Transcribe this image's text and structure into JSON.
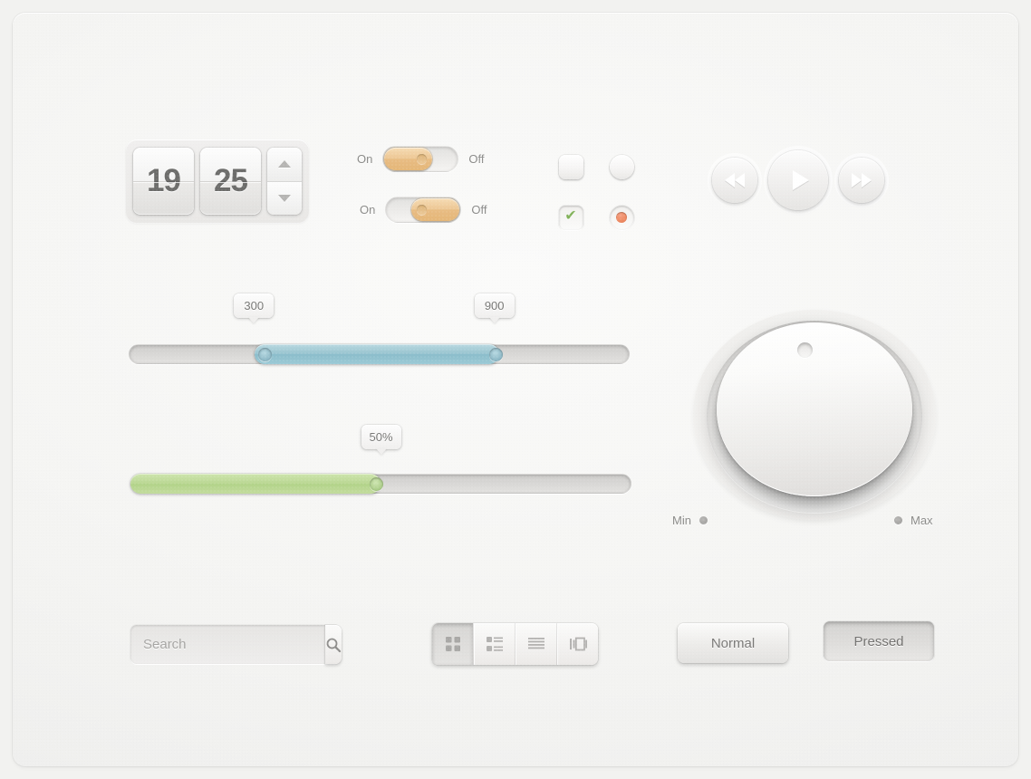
{
  "panel": {
    "background_color": "#f4f4f2",
    "accent_colors": {
      "switch_on": "#e8bc83",
      "range_fill": "#8bbdcb",
      "progress_fill": "#b2d389",
      "check_green": "#82b25a",
      "radio_orange": "#ee8b64",
      "text": "#7a7977"
    }
  },
  "clock": {
    "hours": "19",
    "minutes": "25",
    "stepper": {
      "up_icon": "triangle-up-icon",
      "down_icon": "triangle-down-icon"
    }
  },
  "switches": [
    {
      "on_label": "On",
      "off_label": "Off",
      "state": "on",
      "knob_position": "left"
    },
    {
      "on_label": "On",
      "off_label": "Off",
      "state": "off",
      "knob_position": "right"
    }
  ],
  "choices": {
    "checkbox_unchecked": {
      "checked": false,
      "icon": "checkbox-icon"
    },
    "radio_unselected": {
      "checked": false,
      "icon": "radio-icon"
    },
    "checkbox_checked": {
      "checked": true,
      "icon": "check-mark-icon",
      "glyph": "✔"
    },
    "radio_selected": {
      "checked": true,
      "icon": "radio-dot-icon"
    }
  },
  "media": {
    "rewind_icon": "rewind-icon",
    "play_icon": "play-icon",
    "forward_icon": "fast-forward-icon"
  },
  "range_slider": {
    "min_tooltip": "300",
    "max_tooltip": "900",
    "low_percent": 25,
    "high_percent": 74,
    "fill_color": "#8bbdcb"
  },
  "progress_slider": {
    "tooltip": "50%",
    "value_percent": 50,
    "fill_color": "#b2d389"
  },
  "knob": {
    "min_label": "Min",
    "max_label": "Max",
    "indicator_icon": "knob-indicator-icon"
  },
  "search": {
    "placeholder": "Search",
    "value": "",
    "button_icon": "search-icon"
  },
  "segmented": {
    "items": [
      {
        "icon": "grid-view-icon",
        "active": true
      },
      {
        "icon": "list-view-icon",
        "active": false
      },
      {
        "icon": "lines-view-icon",
        "active": false
      },
      {
        "icon": "coverflow-view-icon",
        "active": false
      }
    ]
  },
  "buttons": {
    "normal_label": "Normal",
    "pressed_label": "Pressed"
  }
}
